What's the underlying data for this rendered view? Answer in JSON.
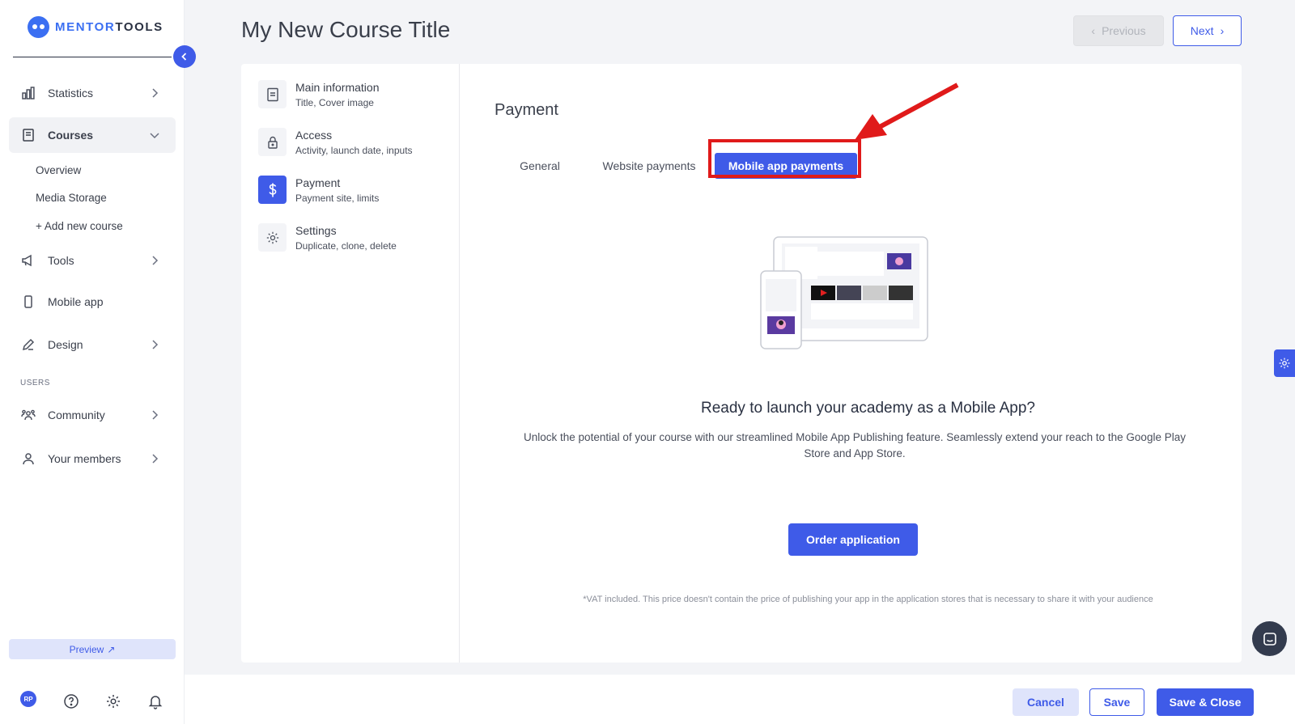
{
  "brand": {
    "name_prefix": "MENTOR",
    "name_suffix": "TOOLS"
  },
  "sidebar": {
    "items": [
      {
        "label": "Statistics",
        "icon": "bar-chart-icon"
      },
      {
        "label": "Courses",
        "icon": "book-icon"
      },
      {
        "label": "Tools",
        "icon": "megaphone-icon"
      },
      {
        "label": "Mobile app",
        "icon": "phone-icon"
      },
      {
        "label": "Design",
        "icon": "pencil-icon"
      },
      {
        "label": "Community",
        "icon": "group-icon"
      },
      {
        "label": "Your members",
        "icon": "user-icon"
      }
    ],
    "courses_sub": [
      "Overview",
      "Media Storage",
      "+ Add new course"
    ],
    "section_users": "USERS",
    "preview_label": "Preview",
    "avatar_initials": "RP"
  },
  "header": {
    "title": "My New Course Title",
    "prev_label": "Previous",
    "next_label": "Next"
  },
  "steps": [
    {
      "title": "Main information",
      "subtitle": "Title, Cover image",
      "icon": "document-icon"
    },
    {
      "title": "Access",
      "subtitle": "Activity, launch date, inputs",
      "icon": "lock-icon"
    },
    {
      "title": "Payment",
      "subtitle": "Payment site, limits",
      "icon": "dollar-icon"
    },
    {
      "title": "Settings",
      "subtitle": "Duplicate, clone, delete",
      "icon": "gear-icon"
    }
  ],
  "payment": {
    "title": "Payment",
    "tabs": [
      "General",
      "Website payments",
      "Mobile app payments"
    ],
    "active_tab": "Mobile app payments",
    "promo_title": "Ready to launch your academy as a Mobile App?",
    "promo_text": "Unlock the potential of your course with our streamlined Mobile App Publishing feature. Seamlessly extend your reach to the Google Play Store and App Store.",
    "order_label": "Order application",
    "vat_note": "*VAT included. This price doesn't contain the price of publishing your app in the application stores that is necessary to share it with your audience"
  },
  "footer": {
    "cancel_label": "Cancel",
    "save_label": "Save",
    "save_close_label": "Save & Close"
  },
  "colors": {
    "accent": "#3f5be8",
    "highlight": "#e01a1a",
    "text": "#3a3f4b"
  }
}
